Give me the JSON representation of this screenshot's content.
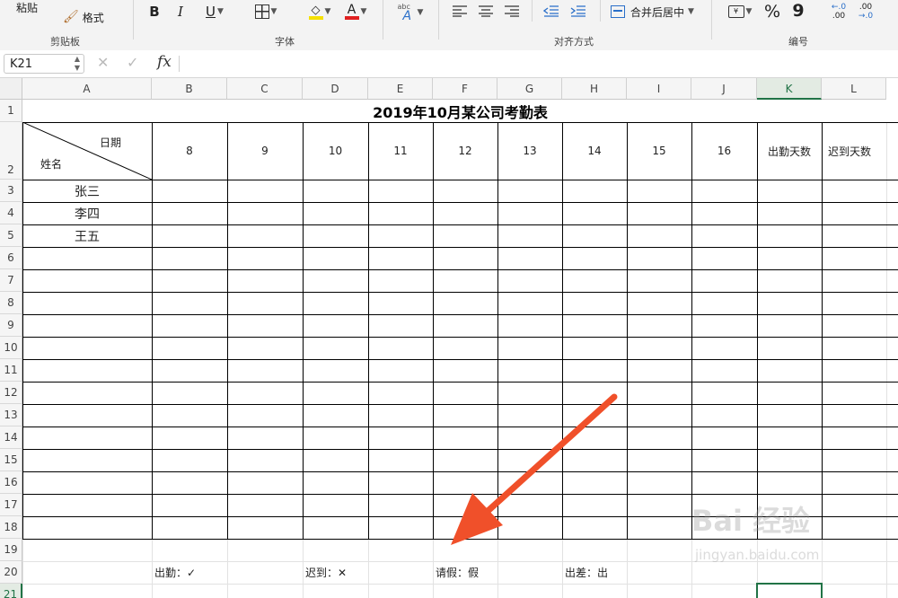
{
  "ribbon": {
    "clipboard": {
      "paste": "粘贴",
      "format": "格式",
      "label": "剪贴板"
    },
    "font": {
      "bold": "B",
      "italic": "I",
      "underline": "U",
      "font_color_glyph": "A",
      "abc": "abc",
      "label": "字体"
    },
    "align": {
      "merge": "合并后居中",
      "label": "对齐方式"
    },
    "number": {
      "percent": "%",
      "comma": "9",
      "dec_inc": ".00",
      "dec_dec": ".0",
      "label": "编号"
    }
  },
  "formula_bar": {
    "name_box": "K21",
    "fx": "fx",
    "formula": ""
  },
  "columns": [
    "A",
    "B",
    "C",
    "D",
    "E",
    "F",
    "G",
    "H",
    "I",
    "J",
    "K",
    "L"
  ],
  "rows": [
    "1",
    "2",
    "3",
    "4",
    "5",
    "6",
    "7",
    "8",
    "9",
    "10",
    "11",
    "12",
    "13",
    "14",
    "15",
    "16",
    "17",
    "18",
    "19",
    "20",
    "21"
  ],
  "table": {
    "title": "2019年10月某公司考勤表",
    "header_date": "日期",
    "header_name": "姓名",
    "days": [
      "8",
      "9",
      "10",
      "11",
      "12",
      "13",
      "14",
      "15",
      "16"
    ],
    "present_days": "出勤天数",
    "late_days": "迟到天数",
    "names": [
      "张三",
      "李四",
      "王五"
    ]
  },
  "legend": {
    "present": "出勤：✓",
    "late": "迟到：✕",
    "leave": "请假：假",
    "business_trip": "出差：出"
  },
  "watermark": {
    "brand": "Bai 经验",
    "url": "jingyan.baidu.com"
  },
  "colors": {
    "selection": "#217346",
    "arrow": "#f0502a",
    "font_color": "#e02020",
    "highlight": "#f5e000"
  }
}
